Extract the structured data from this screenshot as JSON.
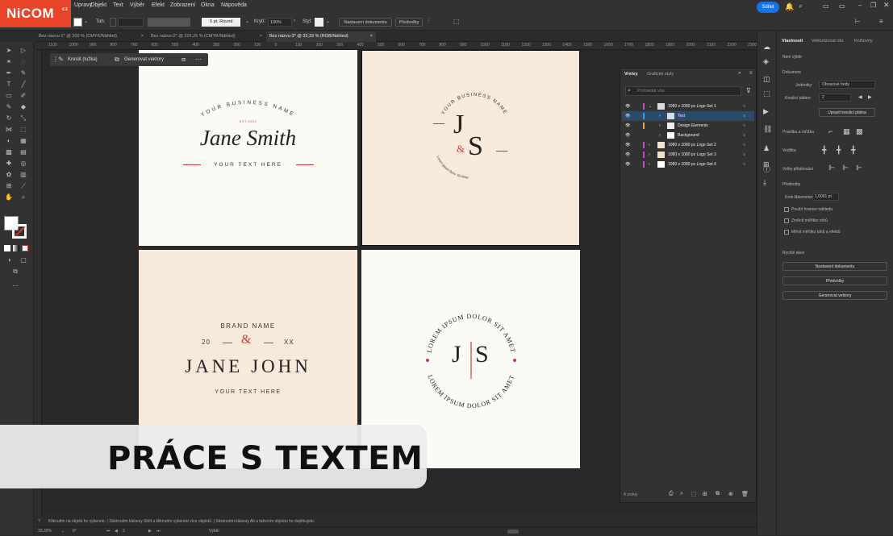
{
  "brand": {
    "logo": "NiCOM",
    "logo_sub": "cz"
  },
  "menu": [
    "Upravy",
    "Objekt",
    "Text",
    "Výběr",
    "Efekt",
    "Zobrazení",
    "Okna",
    "Nápověda"
  ],
  "topright": {
    "share_label": "Sdílet"
  },
  "control": {
    "zoom_label": "Tah:",
    "stroke": "5 pt. Round",
    "opacity_label": "Krytí:",
    "opacity": "100%",
    "style_label": "Styl:",
    "doc_settings": "Nastavení dokumentu",
    "prefs": "Předvolby"
  },
  "doc_tabs": [
    {
      "label": "Bez názvu-1* @ 200 % (CMYK/Náhled)"
    },
    {
      "label": "Bez názvu-2* @ 226,26 % (CMYK/Náhled)"
    },
    {
      "label": "Bez názvu-3* @ 33,33 % (RGB/Náhled)"
    }
  ],
  "ruler_top": [
    "1100",
    "1000",
    "900",
    "800",
    "700",
    "600",
    "500",
    "400",
    "300",
    "200",
    "100",
    "0",
    "100",
    "200",
    "300",
    "400",
    "500",
    "600",
    "700",
    "800",
    "900",
    "1000",
    "1100",
    "1200",
    "1300",
    "1400",
    "1500",
    "1600",
    "1700",
    "1800",
    "1900",
    "2000",
    "2100",
    "2200",
    "2300",
    "2400"
  ],
  "context": {
    "draw": "Kreslit (tužka)",
    "vectorize": "Generovat vektory"
  },
  "logo1": {
    "arc": "YOUR BUSINESS NAME",
    "est": "EST.2022",
    "name": "Jane Smith",
    "sub": "YOUR TEXT HERE"
  },
  "logo2": {
    "arc": "YOUR BUSINESS NAME",
    "j": "J",
    "amp": "&",
    "s": "S",
    "bottom_arc": "Lorem ipsum Dolor Sit Amet"
  },
  "logo3": {
    "brand": "BRAND NAME",
    "left": "20",
    "amp": "&",
    "right": "XX",
    "name": "JANE JOHN",
    "sub": "YOUR TEXT HERE"
  },
  "logo4": {
    "top_arc": "LOREM IPSUM DOLOR SIT AMET",
    "bottom_arc": "LOREM IPSUM DOLOR SIT AMET",
    "j": "J",
    "s": "S"
  },
  "layers": {
    "tab1": "Vrstvy",
    "tab2": "Grafické styly",
    "search": "Prohledat vše",
    "rows": [
      {
        "name": "1080 x 1080 px Logo Set 1"
      },
      {
        "name": "Text"
      },
      {
        "name": "Design Elements"
      },
      {
        "name": "Background"
      },
      {
        "name": "1080 x 1080 px Logo Set 2"
      },
      {
        "name": "1080 x 1080 px Logo Set 3"
      },
      {
        "name": "1080 x 1080 px Logo Set 4"
      }
    ],
    "count": "4 vrstvy"
  },
  "props": {
    "tabs": [
      "Vlastnosti",
      "Vektorizovat obr.",
      "Knihovny"
    ],
    "no_selection": "Není výběr",
    "document": "Dokument",
    "units_label": "Jednotky:",
    "units": "Obrazové body",
    "artboard_label": "Kreslicí plátno:",
    "artboard": "2",
    "edit_artboards": "Upravit kreslicí plátna",
    "rulers": "Pravítka a mřížka",
    "guides": "Vodítka",
    "snap": "Volby přitahování",
    "prefs": "Předvolby",
    "keyinc_label": "Krok klávesnice:",
    "keyinc": "1,0001 pt",
    "cb1": "Použít hranice náhledu",
    "cb2": "Změnit měřítko rohů",
    "cb3": "Měnit měřítko tahů a efektů",
    "quick": "Rychlé akce",
    "btn1": "Nastavení dokumentu",
    "btn2": "Předvolby",
    "btn3": "Generovat vektory"
  },
  "status": "Kliknutím na objekt ho vyberete.  |  Stisknutím klávesy Shift a kliknutím vyberete více objektů.  |  Stisknutím klávesy Alt a tažením objektu ho duplikujete.",
  "zoom": {
    "value": "33,33%",
    "angle": "0°",
    "artboard": "2",
    "select": "Výběr"
  },
  "banner": "PRÁCE S TEXTEM",
  "colors": {
    "accent": "#d23a3a",
    "beige": "#f8eadb",
    "cream": "#fcfaf5",
    "brand": "#e8452a"
  }
}
